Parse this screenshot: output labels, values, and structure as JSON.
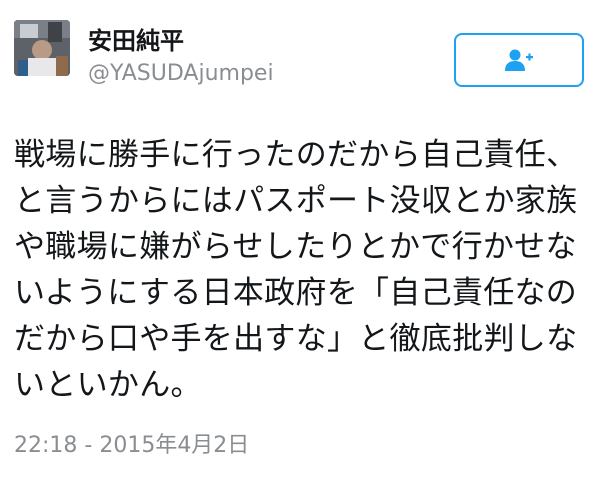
{
  "user": {
    "display_name": "安田純平",
    "handle": "@YASUDAjumpei",
    "avatar_icon": "profile-photo"
  },
  "follow_button": {
    "icon": "add-person-icon",
    "accent_color": "#1da1f2"
  },
  "tweet": {
    "text": "戦場に勝手に行ったのだから自己責任、と言うからにはパスポート没収とか家族や職場に嫌がらせしたりとかで行かせないようにする日本政府を「自己責任なのだから口や手を出すな」と徹底批判しないといかん。",
    "timestamp": "22:18 - 2015年4月2日"
  },
  "colors": {
    "text": "#14171a",
    "secondary_text": "#8a8d91",
    "accent": "#1da1f2"
  }
}
